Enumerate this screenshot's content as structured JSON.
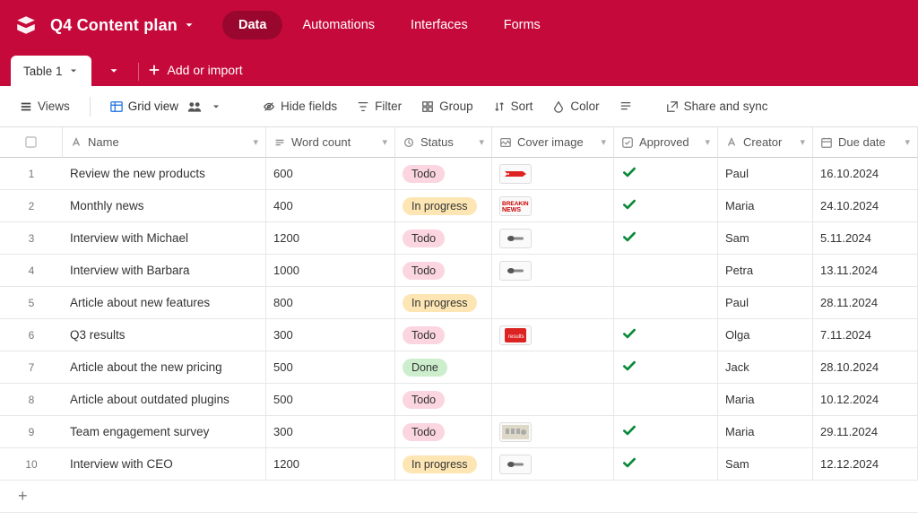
{
  "header": {
    "base_name": "Q4 Content plan",
    "tabs": [
      "Data",
      "Automations",
      "Interfaces",
      "Forms"
    ],
    "active_tab": 0
  },
  "tabstrip": {
    "table_name": "Table 1",
    "add_label": "Add or import"
  },
  "toolbar": {
    "views": "Views",
    "grid_view": "Grid view",
    "hide_fields": "Hide fields",
    "filter": "Filter",
    "group": "Group",
    "sort": "Sort",
    "color": "Color",
    "share": "Share and sync"
  },
  "columns": [
    {
      "key": "name",
      "label": "Name",
      "icon": "text"
    },
    {
      "key": "word_count",
      "label": "Word count",
      "icon": "number"
    },
    {
      "key": "status",
      "label": "Status",
      "icon": "select"
    },
    {
      "key": "cover",
      "label": "Cover image",
      "icon": "attach"
    },
    {
      "key": "approved",
      "label": "Approved",
      "icon": "checkbox"
    },
    {
      "key": "creator",
      "label": "Creator",
      "icon": "text"
    },
    {
      "key": "due_date",
      "label": "Due date",
      "icon": "date"
    }
  ],
  "status_styles": {
    "Todo": "pill-todo",
    "In progress": "pill-prog",
    "Done": "pill-done"
  },
  "rows": [
    {
      "n": 1,
      "name": "Review the new products",
      "word_count": "600",
      "status": "Todo",
      "cover": "banner-red",
      "approved": true,
      "creator": "Paul",
      "due_date": "16.10.2024"
    },
    {
      "n": 2,
      "name": "Monthly news",
      "word_count": "400",
      "status": "In progress",
      "cover": "breaking-news",
      "approved": true,
      "creator": "Maria",
      "due_date": "24.10.2024"
    },
    {
      "n": 3,
      "name": "Interview with Michael",
      "word_count": "1200",
      "status": "Todo",
      "cover": "mic",
      "approved": true,
      "creator": "Sam",
      "due_date": "5.11.2024"
    },
    {
      "n": 4,
      "name": "Interview with Barbara",
      "word_count": "1000",
      "status": "Todo",
      "cover": "mic",
      "approved": false,
      "creator": "Petra",
      "due_date": "13.11.2024"
    },
    {
      "n": 5,
      "name": "Article about new features",
      "word_count": "800",
      "status": "In progress",
      "cover": "",
      "approved": false,
      "creator": "Paul",
      "due_date": "28.11.2024"
    },
    {
      "n": 6,
      "name": "Q3 results",
      "word_count": "300",
      "status": "Todo",
      "cover": "results-red",
      "approved": true,
      "creator": "Olga",
      "due_date": "7.11.2024"
    },
    {
      "n": 7,
      "name": "Article about the new pricing",
      "word_count": "500",
      "status": "Done",
      "cover": "",
      "approved": true,
      "creator": "Jack",
      "due_date": "28.10.2024"
    },
    {
      "n": 8,
      "name": "Article about outdated plugins",
      "word_count": "500",
      "status": "Todo",
      "cover": "",
      "approved": false,
      "creator": "Maria",
      "due_date": "10.12.2024"
    },
    {
      "n": 9,
      "name": "Team engagement survey",
      "word_count": "300",
      "status": "Todo",
      "cover": "survey",
      "approved": true,
      "creator": "Maria",
      "due_date": "29.11.2024"
    },
    {
      "n": 10,
      "name": "Interview with CEO",
      "word_count": "1200",
      "status": "In progress",
      "cover": "mic",
      "approved": true,
      "creator": "Sam",
      "due_date": "12.12.2024"
    }
  ]
}
